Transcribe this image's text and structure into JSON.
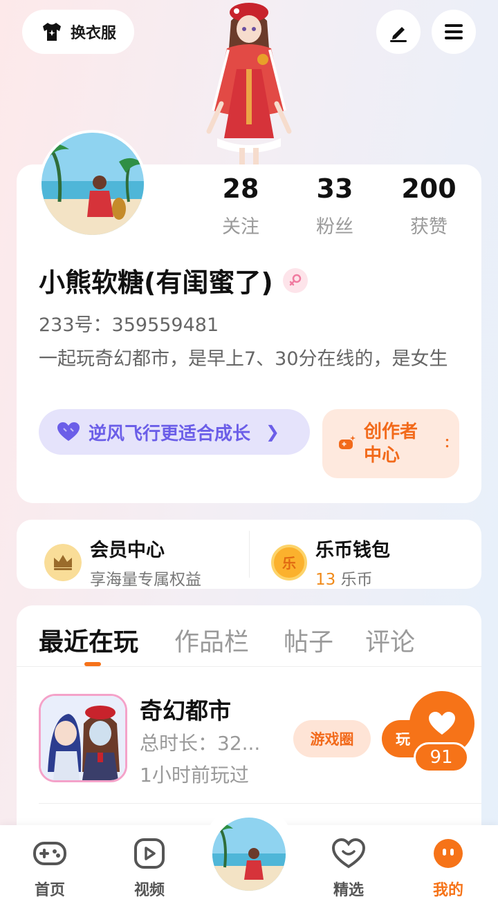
{
  "header": {
    "outfit_label": "换衣服",
    "icons": [
      "tshirt-icon",
      "edit-icon",
      "menu-icon"
    ]
  },
  "profile": {
    "stats": [
      {
        "value": "28",
        "label": "关注"
      },
      {
        "value": "33",
        "label": "粉丝"
      },
      {
        "value": "200",
        "label": "获赞"
      }
    ],
    "nickname": "小熊软糖(有闺蜜了)",
    "gender": "female",
    "uid": "233号：359559481",
    "bio": "一起玩奇幻都市，是早上7、30分在线的，是女生",
    "growth_label": "逆风飞行更适合成长",
    "creator_label": "创作者中心",
    "creator_extra": "："
  },
  "member": {
    "title": "会员中心",
    "subtitle": "享海量专属权益"
  },
  "wallet": {
    "title": "乐币钱包",
    "amount": "13",
    "unit": "乐币",
    "icon_char": "乐"
  },
  "tabs": [
    {
      "label": "最近在玩",
      "active": true
    },
    {
      "label": "作品栏",
      "active": false
    },
    {
      "label": "帖子",
      "active": false
    },
    {
      "label": "评论",
      "active": false
    }
  ],
  "recent_games": [
    {
      "title": "奇幻都市",
      "duration": "总时长：32...",
      "last_played": "1小时前玩过",
      "circle_label": "游戏圈",
      "play_label": "玩"
    }
  ],
  "like_count": "91",
  "bottom_nav": [
    {
      "label": "首页",
      "active": false
    },
    {
      "label": "视频",
      "active": false
    },
    {
      "label": "",
      "active": false
    },
    {
      "label": "精选",
      "active": false
    },
    {
      "label": "我的",
      "active": true
    }
  ],
  "colors": {
    "accent": "#f67318",
    "purple": "#6b5ee8"
  }
}
